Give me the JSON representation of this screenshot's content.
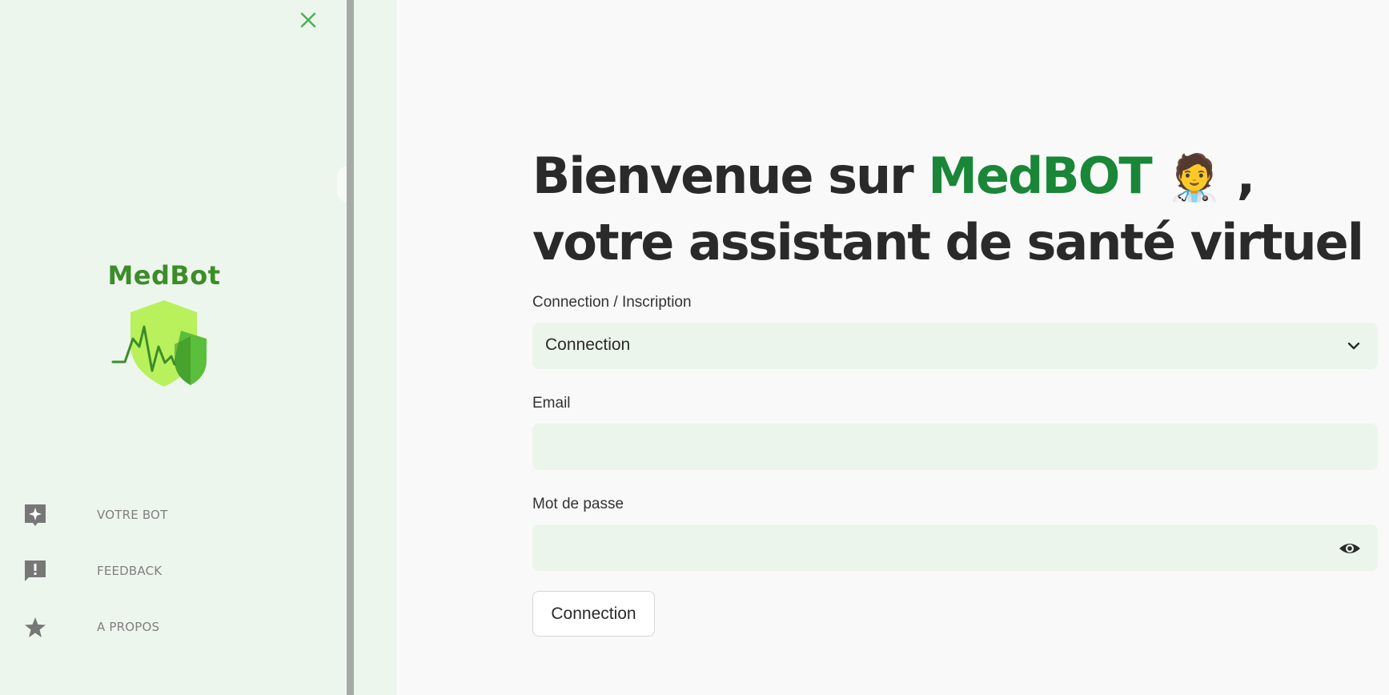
{
  "sidebar": {
    "logo_text": "MedBot",
    "nav": [
      {
        "label": "VOTRE BOT",
        "icon": "sparkle-chat-icon"
      },
      {
        "label": "FEEDBACK",
        "icon": "feedback-alert-icon"
      },
      {
        "label": "A PROPOS",
        "icon": "star-icon"
      }
    ]
  },
  "main": {
    "title_prefix": "Bienvenue sur ",
    "title_brand": "MedBOT",
    "title_emoji": "🧑‍⚕️",
    "title_suffix": ", votre assistant de santé virtuel",
    "mode": {
      "label": "Connection / Inscription",
      "selected": "Connection"
    },
    "email": {
      "label": "Email",
      "value": ""
    },
    "password": {
      "label": "Mot de passe",
      "value": ""
    },
    "submit_label": "Connection"
  },
  "colors": {
    "brand_green": "#198737",
    "sidebar_bg": "#edf6ec",
    "field_bg": "#ecf5eb",
    "close_green": "#4caf50",
    "nav_gray": "#808080"
  }
}
